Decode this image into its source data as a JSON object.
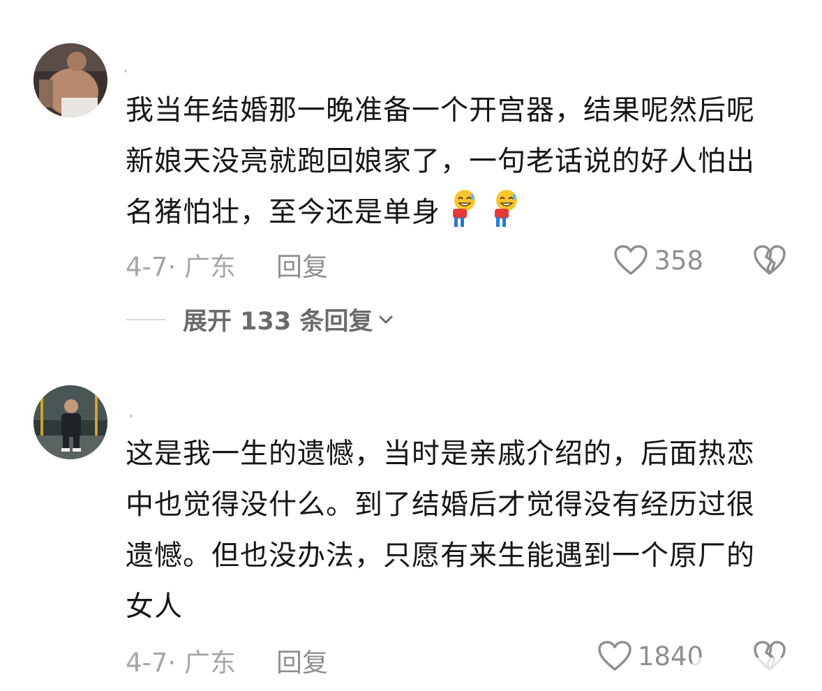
{
  "comments": [
    {
      "text": "我当年结婚那一晚准备一个开宫器，结果呢然后呢新娘天没亮就跑回娘家了，一句老话说的好人怕出名猪怕壮，至今还是单身",
      "emojis": [
        "bow-sweat-emoji",
        "bow-sweat-emoji"
      ],
      "date": "4-7· 广东",
      "reply_label": "回复",
      "likes": "358"
    },
    {
      "text": "这是我一生的遗憾，当时是亲戚介绍的，后面热恋中也觉得没什么。到了结婚后才觉得没有经历过很遗憾。但也没办法，只愿有来生能遇到一个原厂的女人",
      "date": "4-7· 广东",
      "reply_label": "回复",
      "likes": "1840"
    }
  ],
  "expand_replies": "展开 133 条回复",
  "icons": {
    "like": "heart-outline-icon",
    "dislike": "broken-heart-icon",
    "expand": "chevron-down-icon"
  },
  "colors": {
    "text": "#161616",
    "meta": "#a6a6a6",
    "icon": "#8f8f8f"
  }
}
